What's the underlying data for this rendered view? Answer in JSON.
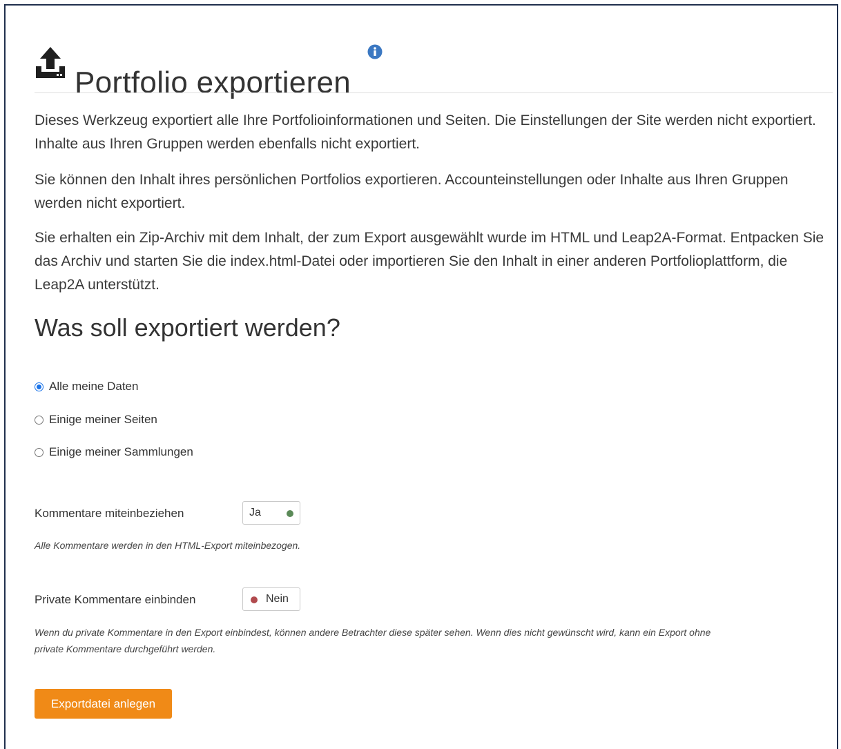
{
  "page": {
    "title": "Portfolio exportieren",
    "title_icon": "upload-icon",
    "help_icon": "info-icon"
  },
  "intro": [
    "Dieses Werkzeug exportiert alle Ihre Portfolioinformationen und Seiten. Die Einstellungen der Site werden nicht exportiert. Inhalte aus Ihren Gruppen werden ebenfalls nicht exportiert.",
    "Sie können den Inhalt ihres persönlichen Portfolios exportieren. Accounteinstellungen oder Inhalte aus Ihren Gruppen werden nicht exportiert.",
    "Sie erhalten ein Zip-Archiv mit dem Inhalt, der zum Export ausgewählt wurde im HTML und Leap2A-Format. Entpacken Sie das Archiv und starten Sie die index.html-Datei oder importieren Sie den Inhalt in einer anderen Portfolioplattform, die Leap2A unterstützt."
  ],
  "export_section": {
    "heading": "Was soll exportiert werden?",
    "options": [
      {
        "label": "Alle meine Daten",
        "selected": true
      },
      {
        "label": "Einige meiner Seiten",
        "selected": false
      },
      {
        "label": "Einige meiner Sammlungen",
        "selected": false
      }
    ]
  },
  "comments": {
    "label": "Kommentare miteinbeziehen",
    "value": "Ja",
    "on": true,
    "help": "Alle Kommentare werden in den HTML-Export miteinbezogen."
  },
  "private_comments": {
    "label": "Private Kommentare einbinden",
    "value": "Nein",
    "on": false,
    "help": "Wenn du private Kommentare in den Export einbindest, können andere Betrachter diese später sehen. Wenn dies nicht gewünscht wird, kann ein Export ohne private Kommentare durchgeführt werden."
  },
  "submit_label": "Exportdatei anlegen",
  "colors": {
    "accent_button": "#f08a17",
    "radio_selected": "#1a73e8",
    "toggle_on": "#5b8a58",
    "toggle_off": "#b14a4e",
    "info_icon": "#3b78c2"
  }
}
